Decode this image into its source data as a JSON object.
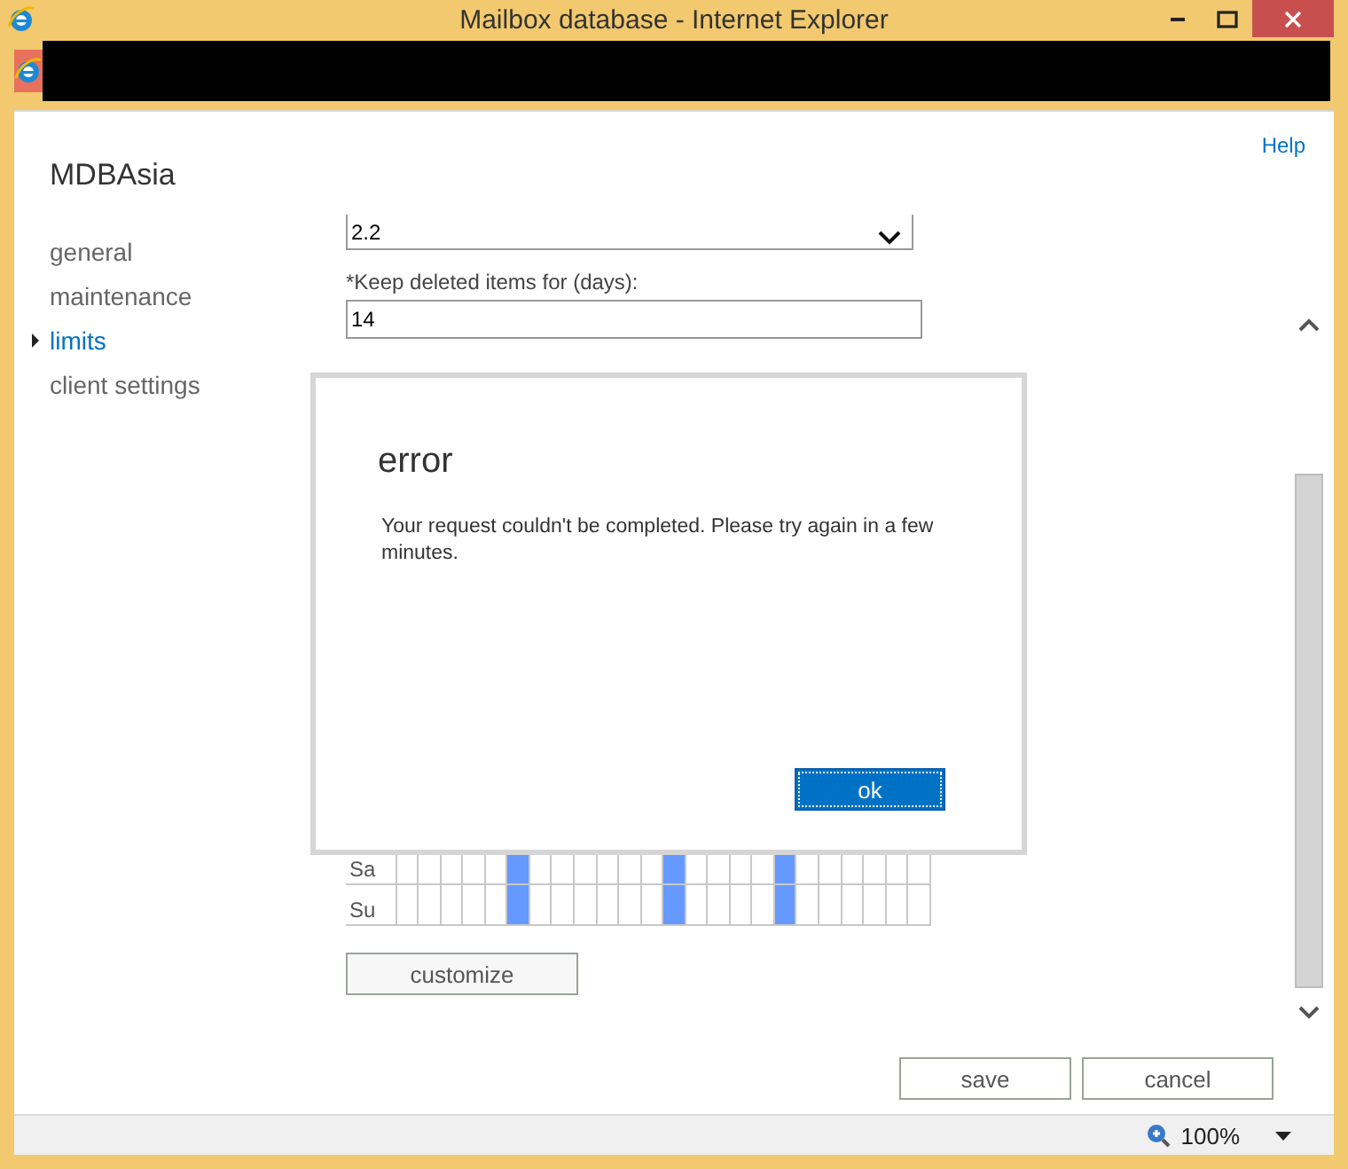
{
  "window": {
    "title": "Mailbox database - Internet Explorer"
  },
  "help_link": "Help",
  "heading": "MDBAsia",
  "nav": [
    {
      "label": "general",
      "selected": false
    },
    {
      "label": "maintenance",
      "selected": false
    },
    {
      "label": "limits",
      "selected": true
    },
    {
      "label": "client settings",
      "selected": false
    }
  ],
  "form": {
    "dropdown_value": "2.2",
    "keep_deleted": {
      "label": "*Keep deleted items for (days):",
      "value": "14"
    }
  },
  "schedule": {
    "rows": [
      {
        "day": "Sa",
        "hours": [
          false,
          false,
          false,
          false,
          false,
          true,
          false,
          false,
          false,
          false,
          false,
          false,
          true,
          false,
          false,
          false,
          false,
          true,
          false,
          false,
          false,
          false,
          false,
          false
        ]
      },
      {
        "day": "Su",
        "hours": [
          false,
          false,
          false,
          false,
          false,
          true,
          false,
          false,
          false,
          false,
          false,
          false,
          true,
          false,
          false,
          false,
          false,
          true,
          false,
          false,
          false,
          false,
          false,
          false
        ]
      }
    ]
  },
  "customize_button": "customize",
  "buttons": [
    "save",
    "cancel"
  ],
  "dialog": {
    "title": "error",
    "message": "Your request couldn't be completed. Please try again in a few minutes.",
    "button": "ok"
  },
  "status_bar": {
    "zoom": "100%"
  }
}
